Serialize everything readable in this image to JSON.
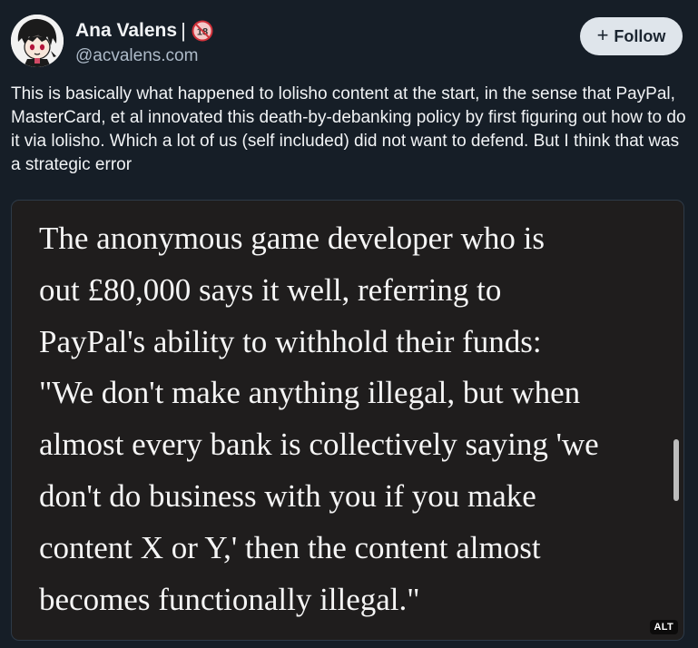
{
  "author": {
    "display_name": "Ana Valens",
    "name_separator": "|",
    "handle": "@acvalens.com",
    "badge_icon": "no-under-18-icon"
  },
  "follow_button": {
    "icon": "plus-icon",
    "plus": "+",
    "label": "Follow"
  },
  "post": {
    "text": "This is basically what happened to lolisho content at the start, in the sense that PayPal, MasterCard, et al innovated this death-by-debanking policy by first figuring out how to do it via lolisho. Which a lot of us (self included) did not want to defend. But I think that was a strategic error"
  },
  "embed": {
    "quote_lines": [
      "The anonymous game developer who is",
      "out £80,000 says it well, referring to",
      "PayPal's ability to withhold their funds:",
      "\"We don't make anything illegal, but when",
      "almost every bank is collectively saying 'we",
      "don't do business with you if you make",
      "content X or Y,' then the content almost",
      "becomes functionally illegal.\""
    ],
    "alt_label": "ALT"
  },
  "colors": {
    "background": "#161e27",
    "text": "#f1f3f5",
    "secondary_text": "#aebbc9",
    "follow_bg": "#dfe5eb",
    "embed_bg": "#1f1d1d"
  }
}
